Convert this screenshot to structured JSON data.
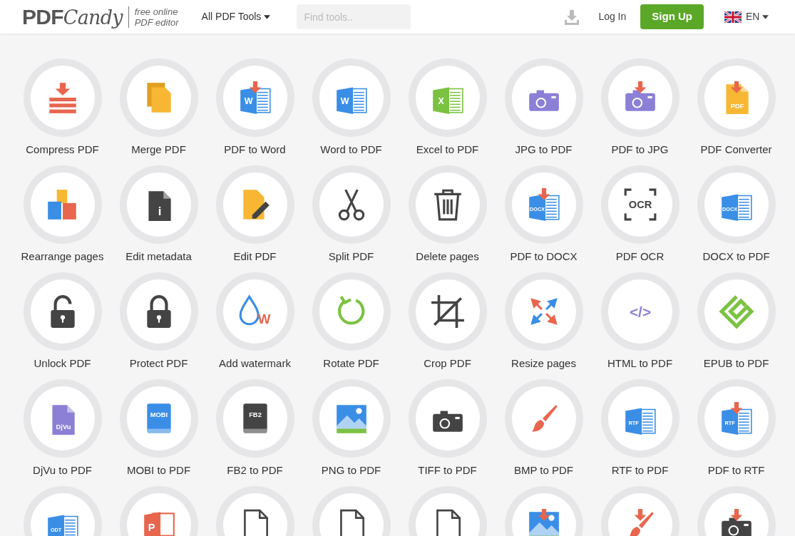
{
  "header": {
    "logo_main": "PDF",
    "logo_script": "Candy",
    "tagline": [
      "free online",
      "PDF editor"
    ],
    "tools_menu": "All PDF Tools",
    "search": {
      "placeholder": "Find tools.."
    },
    "login": "Log In",
    "signup": "Sign Up",
    "language": "EN"
  },
  "tools": [
    {
      "label": "Compress PDF",
      "kind": "compress",
      "color": "#e8664d"
    },
    {
      "label": "Merge PDF",
      "kind": "merge",
      "color": "#f7b733"
    },
    {
      "label": "PDF to Word",
      "kind": "doc",
      "color": "#3a8ee6",
      "text": "W",
      "arrow": true
    },
    {
      "label": "Word to PDF",
      "kind": "doc",
      "color": "#3a8ee6",
      "text": "W",
      "arrow": false
    },
    {
      "label": "Excel to PDF",
      "kind": "doc",
      "color": "#7cc242",
      "text": "X",
      "arrow": false
    },
    {
      "label": "JPG to PDF",
      "kind": "camera",
      "color": "#8b7fd6",
      "arrow": false
    },
    {
      "label": "PDF to JPG",
      "kind": "camera",
      "color": "#8b7fd6",
      "arrow": true
    },
    {
      "label": "PDF Converter",
      "kind": "file",
      "color": "#f7b733",
      "text": "PDF",
      "arrow": true
    },
    {
      "label": "Rearrange pages",
      "kind": "rearrange",
      "color": "#3a8ee6"
    },
    {
      "label": "Edit metadata",
      "kind": "file",
      "color": "#444444",
      "text": "i",
      "arrow": false
    },
    {
      "label": "Edit PDF",
      "kind": "edit",
      "color": "#f7b733"
    },
    {
      "label": "Split PDF",
      "kind": "scissors",
      "color": "#444444"
    },
    {
      "label": "Delete pages",
      "kind": "trash",
      "color": "#444444"
    },
    {
      "label": "PDF to DOCX",
      "kind": "doc",
      "color": "#3a8ee6",
      "text": "DOCX",
      "arrow": true
    },
    {
      "label": "PDF OCR",
      "kind": "ocr",
      "color": "#444444",
      "text": "OCR"
    },
    {
      "label": "DOCX to PDF",
      "kind": "doc",
      "color": "#3a8ee6",
      "text": "DOCX",
      "arrow": false
    },
    {
      "label": "Unlock PDF",
      "kind": "unlock",
      "color": "#444444"
    },
    {
      "label": "Protect PDF",
      "kind": "lock",
      "color": "#444444"
    },
    {
      "label": "Add watermark",
      "kind": "drop",
      "color": "#3a8ee6",
      "text": "W"
    },
    {
      "label": "Rotate PDF",
      "kind": "rotate",
      "color": "#7cc242"
    },
    {
      "label": "Crop PDF",
      "kind": "crop",
      "color": "#444444"
    },
    {
      "label": "Resize pages",
      "kind": "resize",
      "color": "#e8664d"
    },
    {
      "label": "HTML to PDF",
      "kind": "code",
      "color": "#8b7fd6",
      "text": "</>"
    },
    {
      "label": "EPUB to PDF",
      "kind": "epub",
      "color": "#7cc242"
    },
    {
      "label": "DjVu to PDF",
      "kind": "file",
      "color": "#8b7fd6",
      "text": "DjVu",
      "arrow": false
    },
    {
      "label": "MOBI to PDF",
      "kind": "book",
      "color": "#3a8ee6",
      "text": "MOBI"
    },
    {
      "label": "FB2 to PDF",
      "kind": "book",
      "color": "#444444",
      "text": "FB2"
    },
    {
      "label": "PNG to PDF",
      "kind": "photo",
      "color": "#3a8ee6"
    },
    {
      "label": "TIFF to PDF",
      "kind": "camera",
      "color": "#444444",
      "arrow": false
    },
    {
      "label": "BMP to PDF",
      "kind": "brush",
      "color": "#e8664d"
    },
    {
      "label": "RTF to PDF",
      "kind": "doc",
      "color": "#3a8ee6",
      "text": "RTF",
      "arrow": false
    },
    {
      "label": "PDF to RTF",
      "kind": "doc",
      "color": "#3a8ee6",
      "text": "RTF",
      "arrow": true
    },
    {
      "kind": "doc",
      "color": "#3a8ee6",
      "text": "ODT",
      "arrow": false
    },
    {
      "kind": "slides",
      "color": "#e8664d",
      "text": "P"
    },
    {
      "kind": "outline",
      "color": "#444444"
    },
    {
      "kind": "outline",
      "color": "#444444"
    },
    {
      "kind": "outline",
      "color": "#444444"
    },
    {
      "kind": "photo",
      "color": "#3a8ee6",
      "arrow": true
    },
    {
      "kind": "brush",
      "color": "#e8664d",
      "arrow": true
    },
    {
      "kind": "camera",
      "color": "#444444",
      "arrow": true
    }
  ]
}
